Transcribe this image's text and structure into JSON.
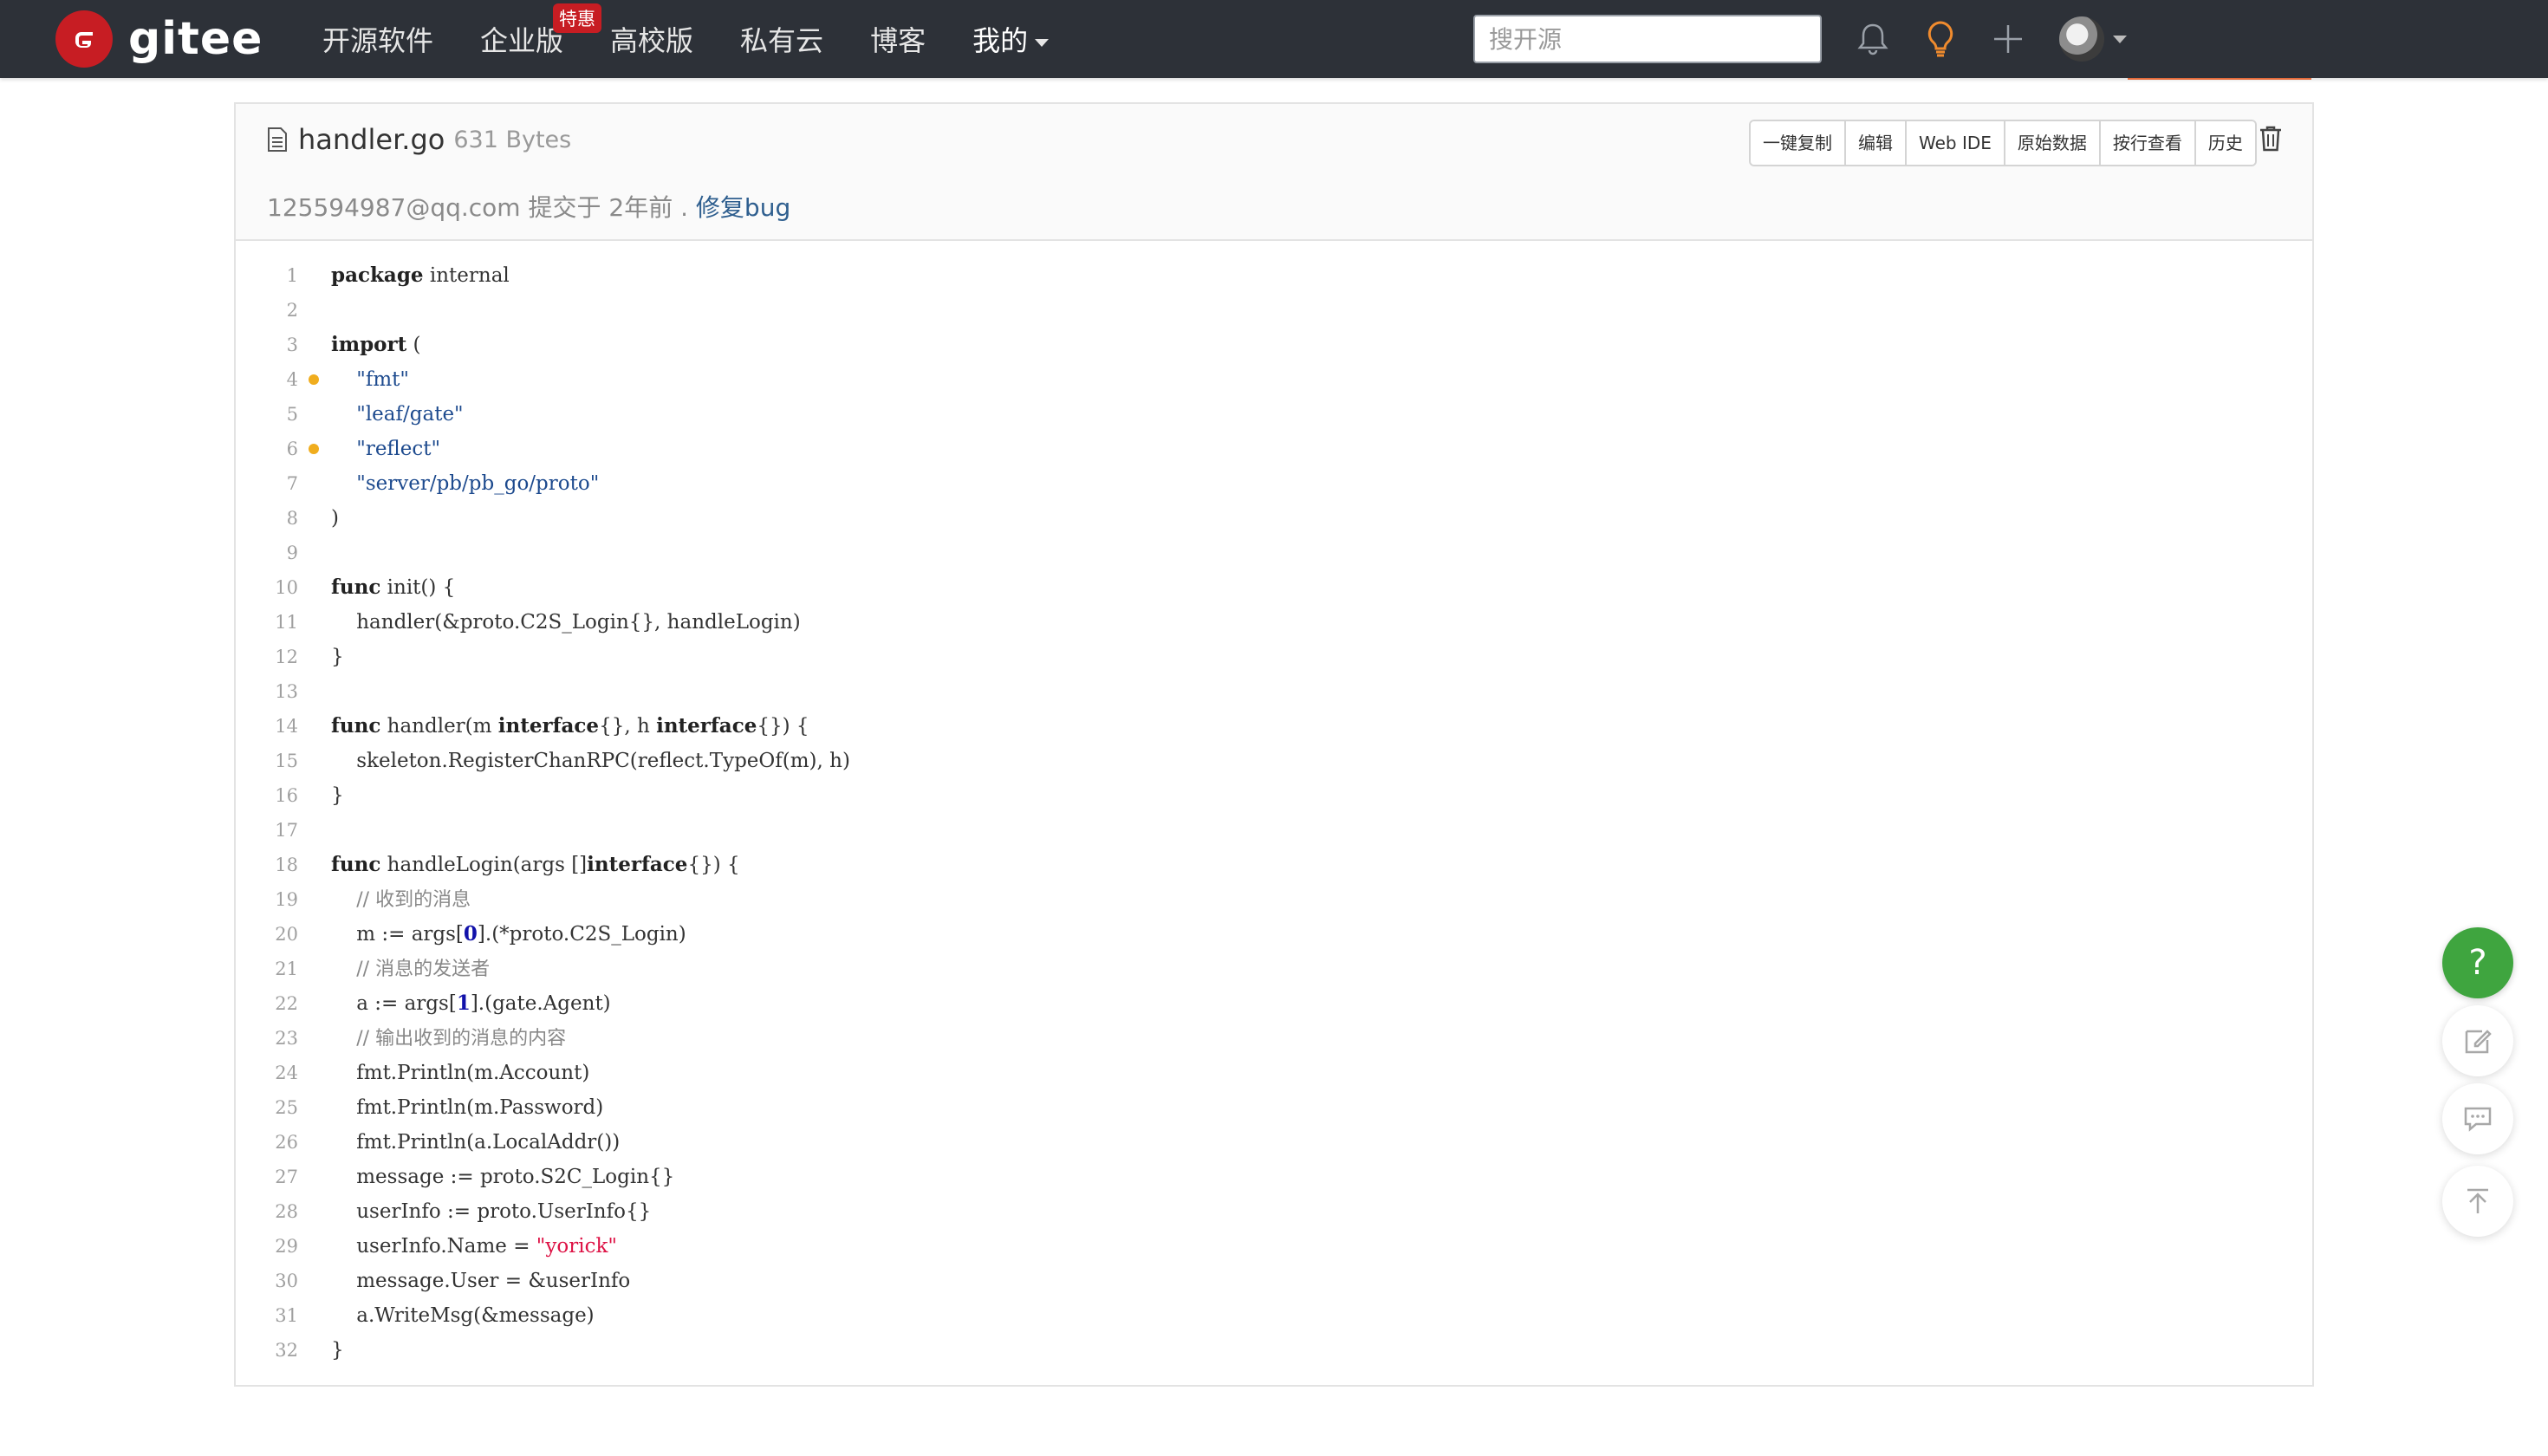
{
  "brand": {
    "name": "gitee"
  },
  "nav": {
    "items": [
      {
        "label": "开源软件"
      },
      {
        "label": "企业版",
        "badge": "特惠"
      },
      {
        "label": "高校版"
      },
      {
        "label": "私有云"
      },
      {
        "label": "博客"
      },
      {
        "label": "我的"
      }
    ],
    "search_placeholder": "搜开源",
    "icons": [
      "bell-icon",
      "lightbulb-icon",
      "plus-icon"
    ]
  },
  "file": {
    "name": "handler.go",
    "size": "631 Bytes",
    "commit_author": "125594987@qq.com",
    "commit_meta": "提交于 2年前 .",
    "commit_message": "修复bug",
    "actions": [
      "一键复制",
      "编辑",
      "Web IDE",
      "原始数据",
      "按行查看",
      "历史"
    ]
  },
  "code": {
    "lines": [
      {
        "n": "1",
        "text": "package internal"
      },
      {
        "n": "2",
        "text": ""
      },
      {
        "n": "3",
        "text": "import ("
      },
      {
        "n": "4",
        "text": "    \"fmt\"",
        "marker": true
      },
      {
        "n": "5",
        "text": "    \"leaf/gate\""
      },
      {
        "n": "6",
        "text": "    \"reflect\"",
        "marker": true
      },
      {
        "n": "7",
        "text": "    \"server/pb/pb_go/proto\""
      },
      {
        "n": "8",
        "text": ")"
      },
      {
        "n": "9",
        "text": ""
      },
      {
        "n": "10",
        "text": "func init() {"
      },
      {
        "n": "11",
        "text": "    handler(&proto.C2S_Login{}, handleLogin)"
      },
      {
        "n": "12",
        "text": "}"
      },
      {
        "n": "13",
        "text": ""
      },
      {
        "n": "14",
        "text": "func handler(m interface{}, h interface{}) {"
      },
      {
        "n": "15",
        "text": "    skeleton.RegisterChanRPC(reflect.TypeOf(m), h)"
      },
      {
        "n": "16",
        "text": "}"
      },
      {
        "n": "17",
        "text": ""
      },
      {
        "n": "18",
        "text": "func handleLogin(args []interface{}) {"
      },
      {
        "n": "19",
        "text": "    // 收到的消息"
      },
      {
        "n": "20",
        "text": "    m := args[0].(*proto.C2S_Login)"
      },
      {
        "n": "21",
        "text": "    // 消息的发送者"
      },
      {
        "n": "22",
        "text": "    a := args[1].(gate.Agent)"
      },
      {
        "n": "23",
        "text": "    // 输出收到的消息的内容"
      },
      {
        "n": "24",
        "text": "    fmt.Println(m.Account)"
      },
      {
        "n": "25",
        "text": "    fmt.Println(m.Password)"
      },
      {
        "n": "26",
        "text": "    fmt.Println(a.LocalAddr())"
      },
      {
        "n": "27",
        "text": "    message := proto.S2C_Login{}"
      },
      {
        "n": "28",
        "text": "    userInfo := proto.UserInfo{}"
      },
      {
        "n": "29",
        "text": "    userInfo.Name = \"yorick\""
      },
      {
        "n": "30",
        "text": "    message.User = &userInfo"
      },
      {
        "n": "31",
        "text": "    a.WriteMsg(&message)"
      },
      {
        "n": "32",
        "text": "}"
      }
    ]
  },
  "float_tools": {
    "help_label": "?"
  },
  "colors": {
    "nav_bg": "#2d3138",
    "brand_red": "#c71d23",
    "help_green": "#3fa53f",
    "marker": "#f0ad1e"
  }
}
